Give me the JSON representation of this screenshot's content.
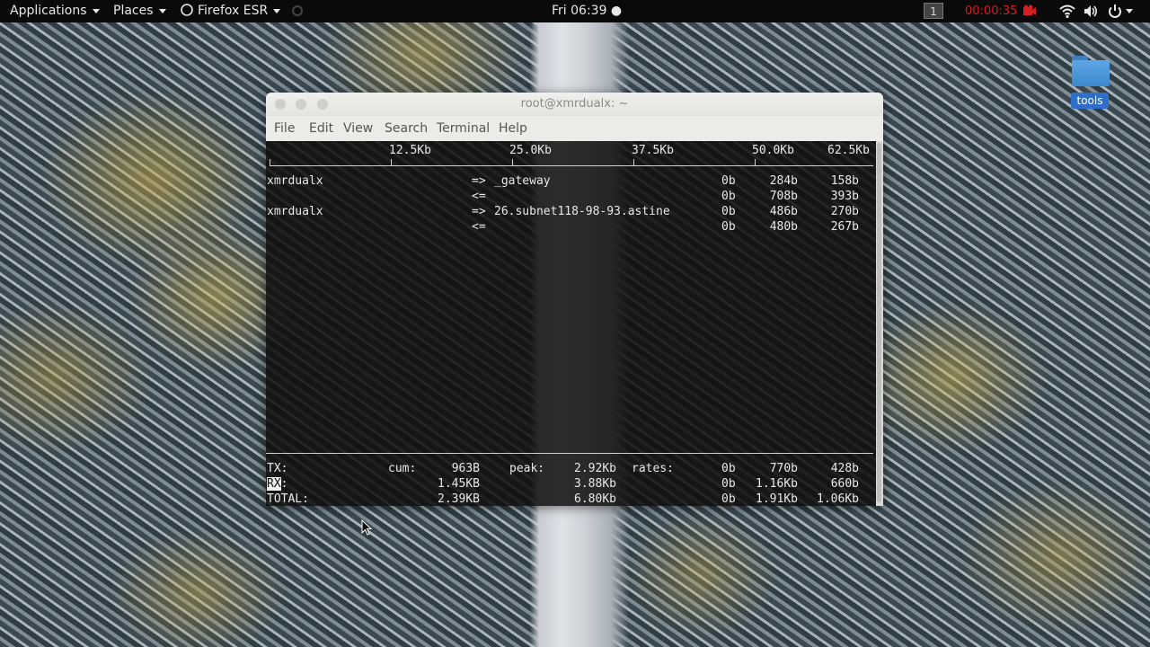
{
  "top_panel": {
    "applications": "Applications",
    "places": "Places",
    "app_name": "Firefox ESR",
    "clock": "Fri 06:39 ●",
    "workspace": "1",
    "recorder_time": "00:00:35"
  },
  "desktop": {
    "folder_label": "tools"
  },
  "window": {
    "title": "root@xmrdualx: ~",
    "menu": [
      "File",
      "Edit",
      "View",
      "Search",
      "Terminal",
      "Help"
    ]
  },
  "iftop": {
    "scale": [
      "12.5Kb",
      "25.0Kb",
      "37.5Kb",
      "50.0Kb",
      "62.5Kb"
    ],
    "connections": [
      {
        "host": "xmrdualx",
        "dir": "=>",
        "peer": "_gateway",
        "r2": "0b",
        "r10": "284b",
        "r40": "158b"
      },
      {
        "host": "",
        "dir": "<=",
        "peer": "",
        "r2": "0b",
        "r10": "708b",
        "r40": "393b"
      },
      {
        "host": "xmrdualx",
        "dir": "=>",
        "peer": "26.subnet118-98-93.astine",
        "r2": "0b",
        "r10": "486b",
        "r40": "270b"
      },
      {
        "host": "",
        "dir": "<=",
        "peer": "",
        "r2": "0b",
        "r10": "480b",
        "r40": "267b"
      }
    ],
    "labels": {
      "cum": "cum:",
      "peak": "peak:",
      "rates": "rates:"
    },
    "totals": [
      {
        "label": "TX:",
        "cum": "963B",
        "peak": "2.92Kb",
        "r2": "0b",
        "r10": "770b",
        "r40": "428b"
      },
      {
        "label": "RX",
        "cum": "1.45KB",
        "peak": "3.88Kb",
        "r2": "0b",
        "r10": "1.16Kb",
        "r40": "660b"
      },
      {
        "label": "TOTAL:",
        "cum": "2.39KB",
        "peak": "6.80Kb",
        "r2": "0b",
        "r10": "1.91Kb",
        "r40": "1.06Kb"
      }
    ]
  }
}
